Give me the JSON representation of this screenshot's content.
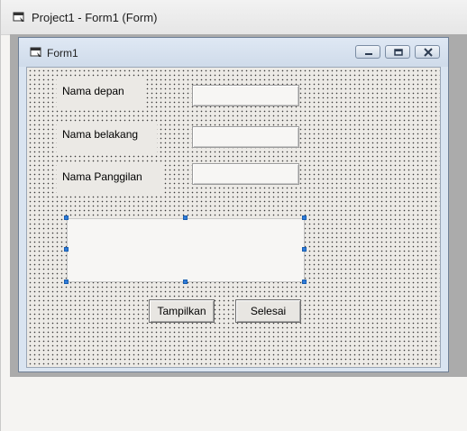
{
  "outer_window": {
    "title": "Project1 - Form1 (Form)"
  },
  "form": {
    "title": "Form1",
    "labels": {
      "nama_depan": "Nama depan",
      "nama_belakang": "Nama belakang",
      "nama_panggilan": "Nama Panggilan"
    },
    "buttons": {
      "tampilkan": "Tampilkan",
      "selesai": "Selesai"
    }
  },
  "icons": {
    "window_icon": "form-window-icon",
    "minimize": "minimize-icon",
    "maximize": "maximize-icon",
    "close": "close-icon"
  },
  "colors": {
    "selection_handle": "#2f7bd8",
    "form_titlebar": "#cfdbea",
    "mdi_background": "#ababab"
  }
}
